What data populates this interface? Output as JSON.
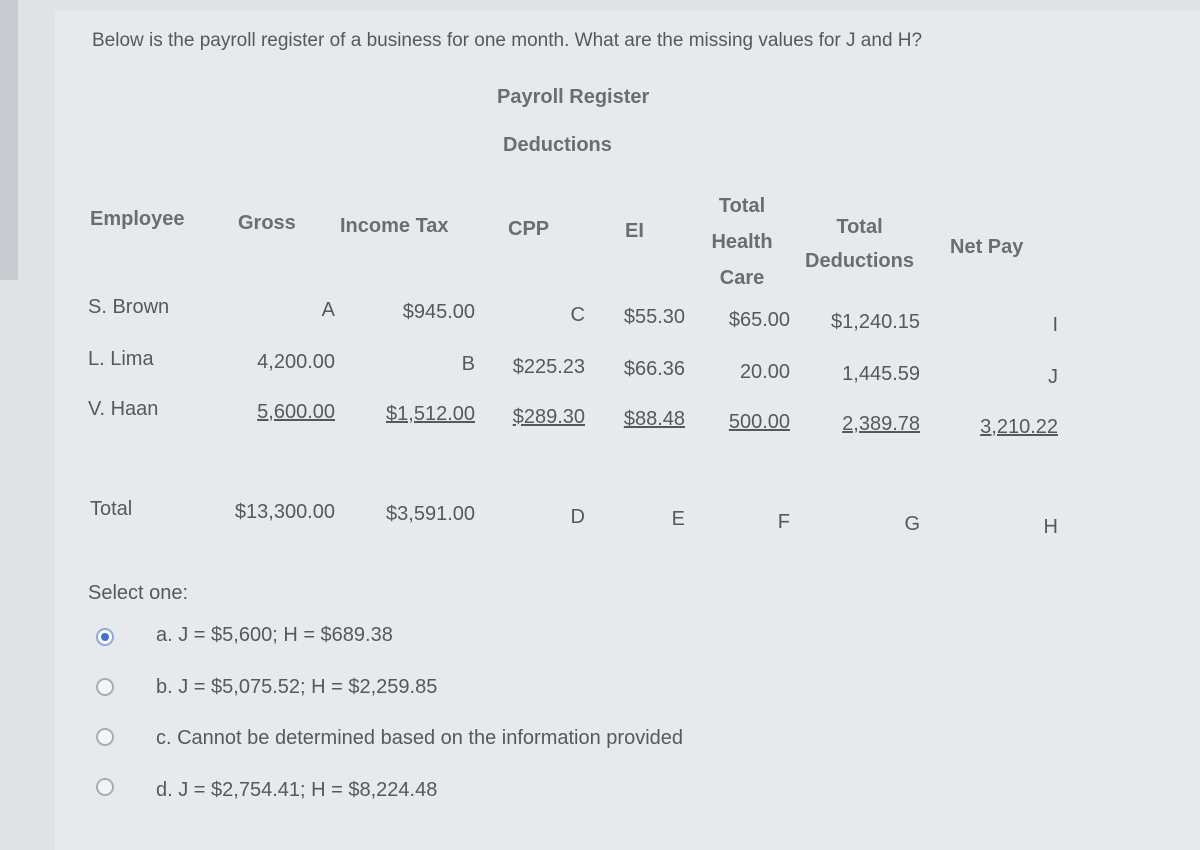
{
  "question": "Below is the payroll register of a business for one month. What are the missing values for J and H?",
  "title": "Payroll Register",
  "subtitle": "Deductions",
  "headers": [
    "Employee",
    "Gross",
    "Income Tax",
    "CPP",
    "EI",
    "Total Health Care",
    "Total Deductions",
    "Net Pay"
  ],
  "rows": [
    [
      "S. Brown",
      "A",
      "$945.00",
      "C",
      "$55.30",
      "$65.00",
      "$1,240.15",
      "I"
    ],
    [
      "L. Lima",
      "4,200.00",
      "B",
      "$225.23",
      "$66.36",
      "20.00",
      "1,445.59",
      "J"
    ],
    [
      "V. Haan",
      "5,600.00",
      "$1,512.00",
      "$289.30",
      "$88.48",
      "500.00",
      "2,389.78",
      "3,210.22"
    ],
    [
      "Total",
      "$13,300.00",
      "$3,591.00",
      "D",
      "E",
      "F",
      "G",
      "H"
    ]
  ],
  "select_label": "Select one:",
  "options": [
    {
      "label": "a. J = $5,600; H = $689.38",
      "selected": true
    },
    {
      "label": "b. J = $5,075.52; H = $2,259.85",
      "selected": false
    },
    {
      "label": "c. Cannot be determined based on the information provided",
      "selected": false
    },
    {
      "label": "d. J = $2,754.41; H = $8,224.48",
      "selected": false
    }
  ]
}
